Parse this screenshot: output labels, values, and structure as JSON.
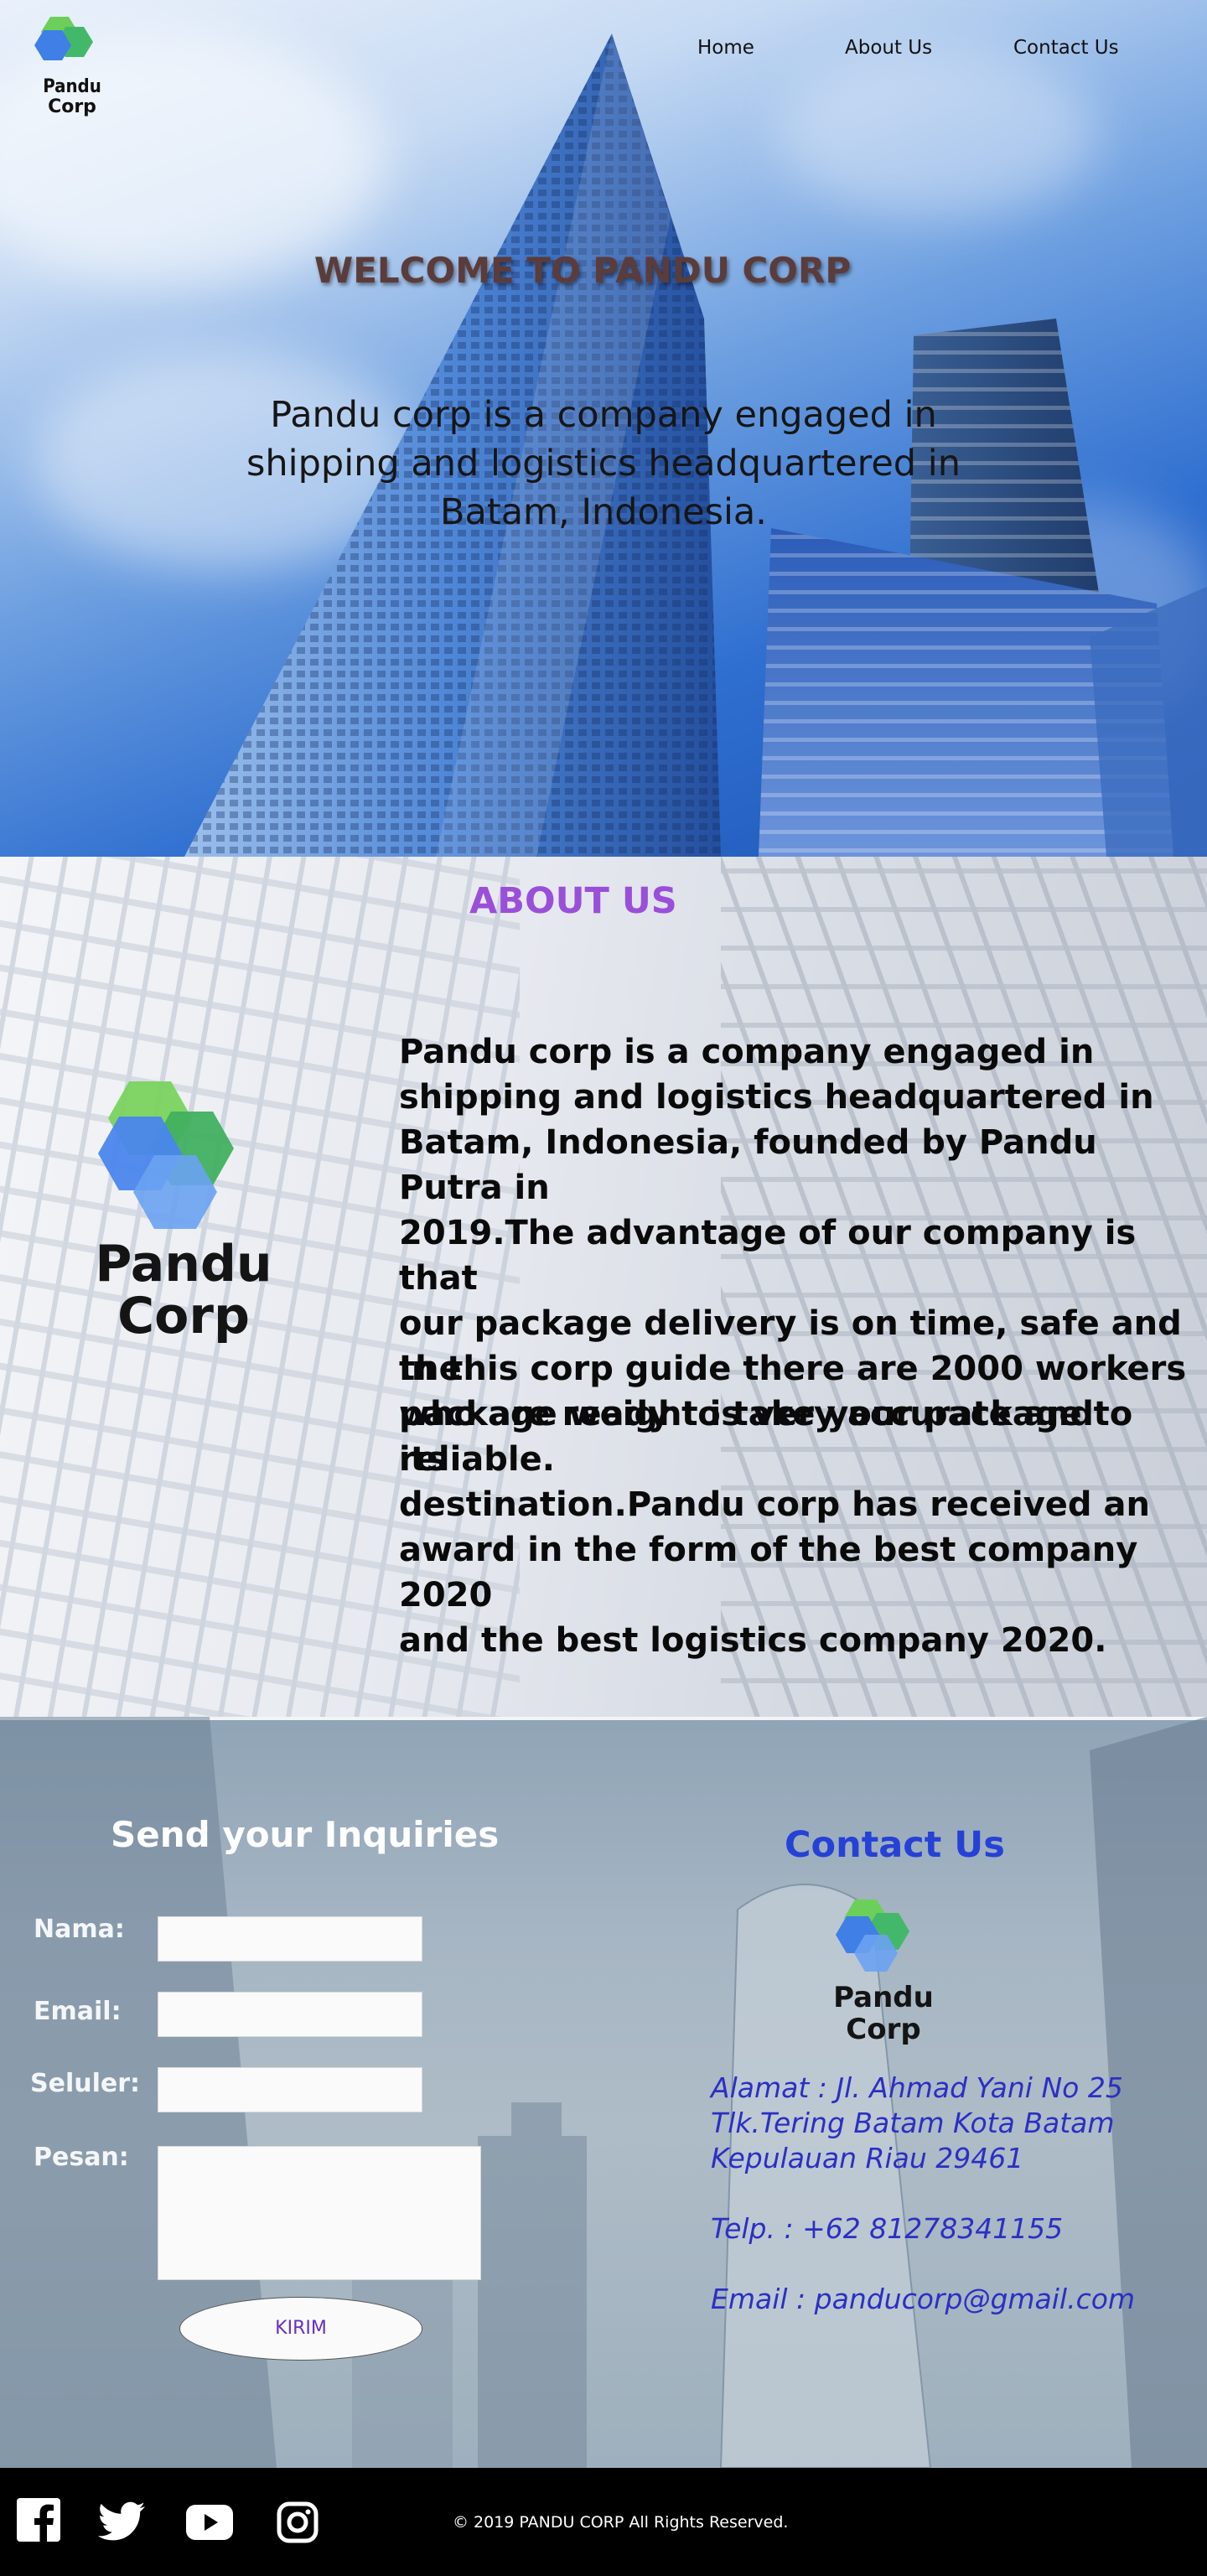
{
  "brand": {
    "logo_line1": "Pandu",
    "logo_line2": "Corp"
  },
  "nav": {
    "home": "Home",
    "about": "About Us",
    "contact": "Contact Us"
  },
  "hero": {
    "title": "WELCOME TO PANDU CORP",
    "line1": "Pandu corp is a company engaged in",
    "line2": "shipping and logistics headquartered in",
    "line3": "Batam, Indonesia."
  },
  "about": {
    "title": "ABOUT US",
    "p1": [
      "Pandu corp is a company engaged in",
      "shipping and logistics headquartered in",
      "Batam, Indonesia, founded by Pandu Putra in",
      "2019.The advantage of our company is that",
      "our package delivery is on time, safe and the",
      "package weight is very accurate and reliable."
    ],
    "p2": [
      "In this corp guide there are 2000 workers",
      "who are ready to take your package to its",
      "destination.Pandu corp has received an",
      "award in the form of the best company 2020",
      "and the best logistics company 2020."
    ]
  },
  "form": {
    "title": "Send your Inquiries",
    "name_label": "Nama:",
    "email_label": "Email:",
    "phone_label": "Seluler:",
    "message_label": "Pesan:",
    "submit": "KIRIM"
  },
  "contact": {
    "title": "Contact Us",
    "address1": "Alamat : Jl. Ahmad Yani No 25",
    "address2": "Tlk.Tering Batam Kota Batam",
    "address3": "Kepulauan Riau 29461",
    "phone": "Telp. : +62 81278341155",
    "email": "Email : panducorp@gmail.com"
  },
  "footer": {
    "copyright": "© 2019 PANDU CORP  All Rights Reserved."
  },
  "icons": [
    "facebook-icon",
    "twitter-icon",
    "youtube-icon",
    "instagram-icon"
  ],
  "colors": {
    "about_title": "#9a4fd9",
    "contact_blue": "#2541d6",
    "submit_text": "#6a2fc0",
    "footer_bg": "#000000"
  }
}
